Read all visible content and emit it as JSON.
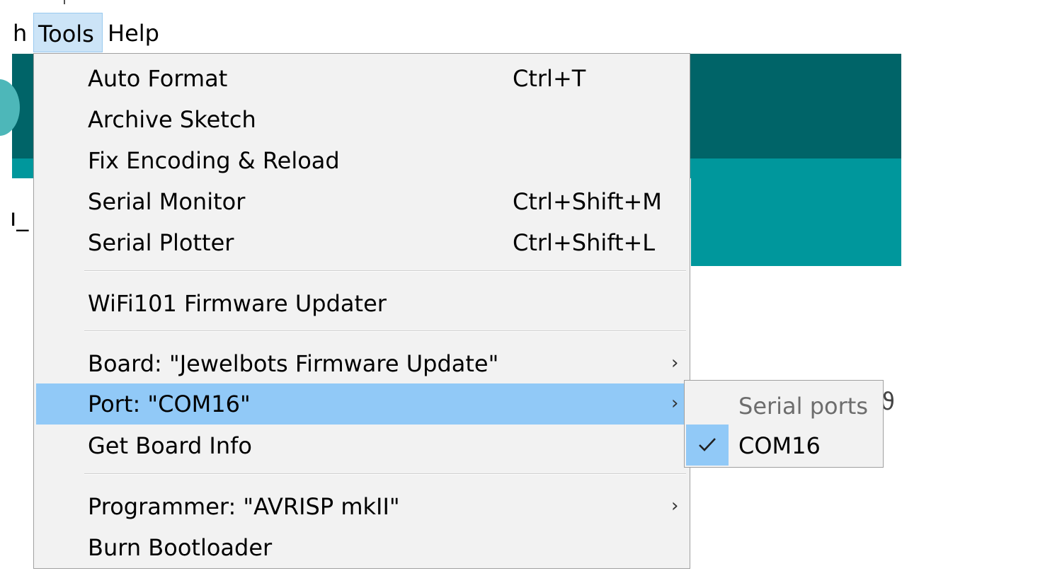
{
  "menubar": {
    "sketch_fragment": "h",
    "tools_label": "Tools",
    "help_label": "Help"
  },
  "background": {
    "fragment_left": "ו_"
  },
  "tools_menu": {
    "items": [
      {
        "label": "Auto Format",
        "shortcut": "Ctrl+T"
      },
      {
        "label": "Archive Sketch",
        "shortcut": ""
      },
      {
        "label": "Fix Encoding & Reload",
        "shortcut": ""
      },
      {
        "label": "Serial Monitor",
        "shortcut": "Ctrl+Shift+M"
      },
      {
        "label": "Serial Plotter",
        "shortcut": "Ctrl+Shift+L"
      },
      {
        "label": "WiFi101 Firmware Updater",
        "shortcut": ""
      },
      {
        "label": "Board: \"Jewelbots Firmware Update\"",
        "submenu_arrow": "›"
      },
      {
        "label": "Port: \"COM16\"",
        "submenu_arrow": "›",
        "highlighted": true
      },
      {
        "label": "Get Board Info",
        "shortcut": ""
      },
      {
        "label": "Programmer: \"AVRISP mkII\"",
        "submenu_arrow": "›"
      },
      {
        "label": "Burn Bootloader",
        "shortcut": ""
      }
    ]
  },
  "port_submenu": {
    "header": "Serial ports",
    "items": [
      {
        "label": "COM16",
        "checked": true
      }
    ]
  },
  "colors": {
    "highlight": "#91c9f7",
    "menu_bg": "#f2f2f2",
    "ide_dark_teal": "#006468",
    "ide_teal": "#00979c"
  }
}
